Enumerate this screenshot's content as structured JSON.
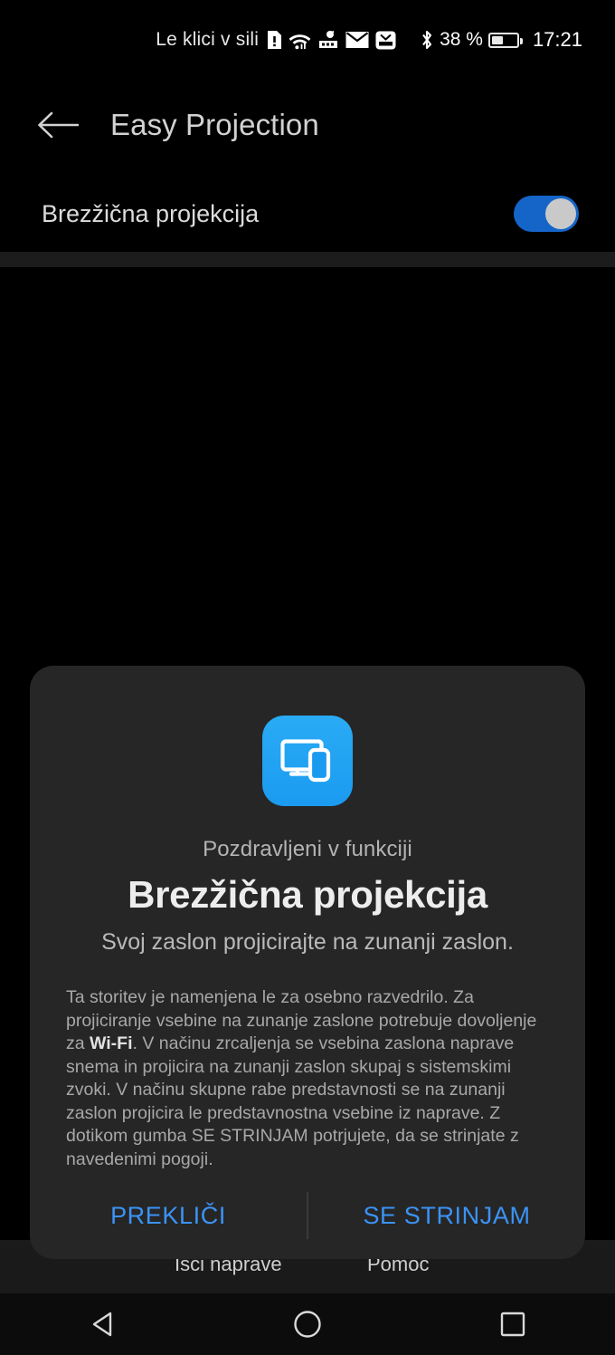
{
  "status_bar": {
    "carrier_text": "Le klici v sili",
    "icons": [
      "sim-alert-icon",
      "wifi-icon",
      "wifi-calling-icon",
      "mail-icon",
      "huawei-app-icon",
      "bluetooth-icon"
    ],
    "battery_percent": "38 %",
    "battery_level": 40,
    "time": "17:21"
  },
  "app_bar": {
    "back_icon": "back-arrow-icon",
    "title": "Easy Projection"
  },
  "settings": {
    "toggle_label": "Brezžična projekcija",
    "toggle_on": true,
    "toggle_accent": "#1565c8"
  },
  "background": {
    "search_devices_label": "Išči naprave",
    "help_label": "Pomoč"
  },
  "dialog": {
    "icon": "screen-cast-icon",
    "icon_color": "#1b9bf0",
    "eyebrow": "Pozdravljeni v funkciji",
    "title": "Brezžična projekcija",
    "subtitle": "Svoj zaslon projicirajte na zunanji zaslon.",
    "body_part1": "Ta storitev je namenjena le za osebno razvedrilo. Za projiciranje vsebine na zunanje zaslone potrebuje dovoljenje za ",
    "body_bold": "Wi-Fi",
    "body_part2": ". V načinu zrcaljenja se vsebina zaslona naprave snema in projicira na zunanji zaslon skupaj s sistemskimi zvoki. V načinu skupne rabe predstavnosti se na zunanji zaslon projicira le predstavnostna vsebine iz naprave. Z dotikom gumba SE STRINJAM potrjujete, da se strinjate z navedenimi pogoji.",
    "cancel_label": "PREKLIČI",
    "agree_label": "SE STRINJAM",
    "button_color": "#3b93f5"
  },
  "nav_bar": {
    "back_key": "nav-back-triangle-icon",
    "home_key": "nav-home-circle-icon",
    "recents_key": "nav-recents-square-icon"
  }
}
